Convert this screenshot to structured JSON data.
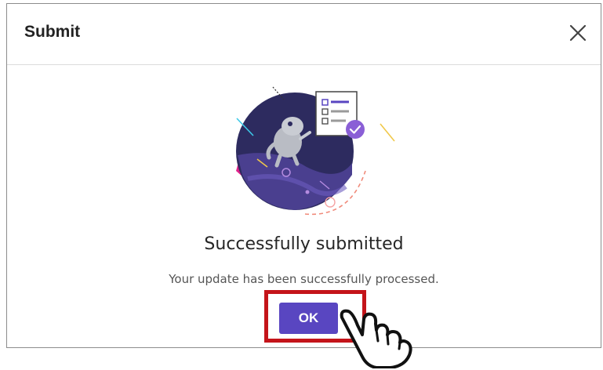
{
  "dialog": {
    "title": "Submit",
    "close_icon": "close-icon"
  },
  "illustration": {
    "icon": "success-illustration"
  },
  "message": {
    "title": "Successfully submitted",
    "body": "Your update has been successfully processed."
  },
  "actions": {
    "ok_label": "OK"
  },
  "annotation": {
    "highlight_color": "#c4141a",
    "cursor_icon": "pointing-hand-icon"
  },
  "colors": {
    "primary_button": "#5946c1",
    "accent_pink": "#e0218a",
    "illustration_navy": "#2d2b5f"
  }
}
